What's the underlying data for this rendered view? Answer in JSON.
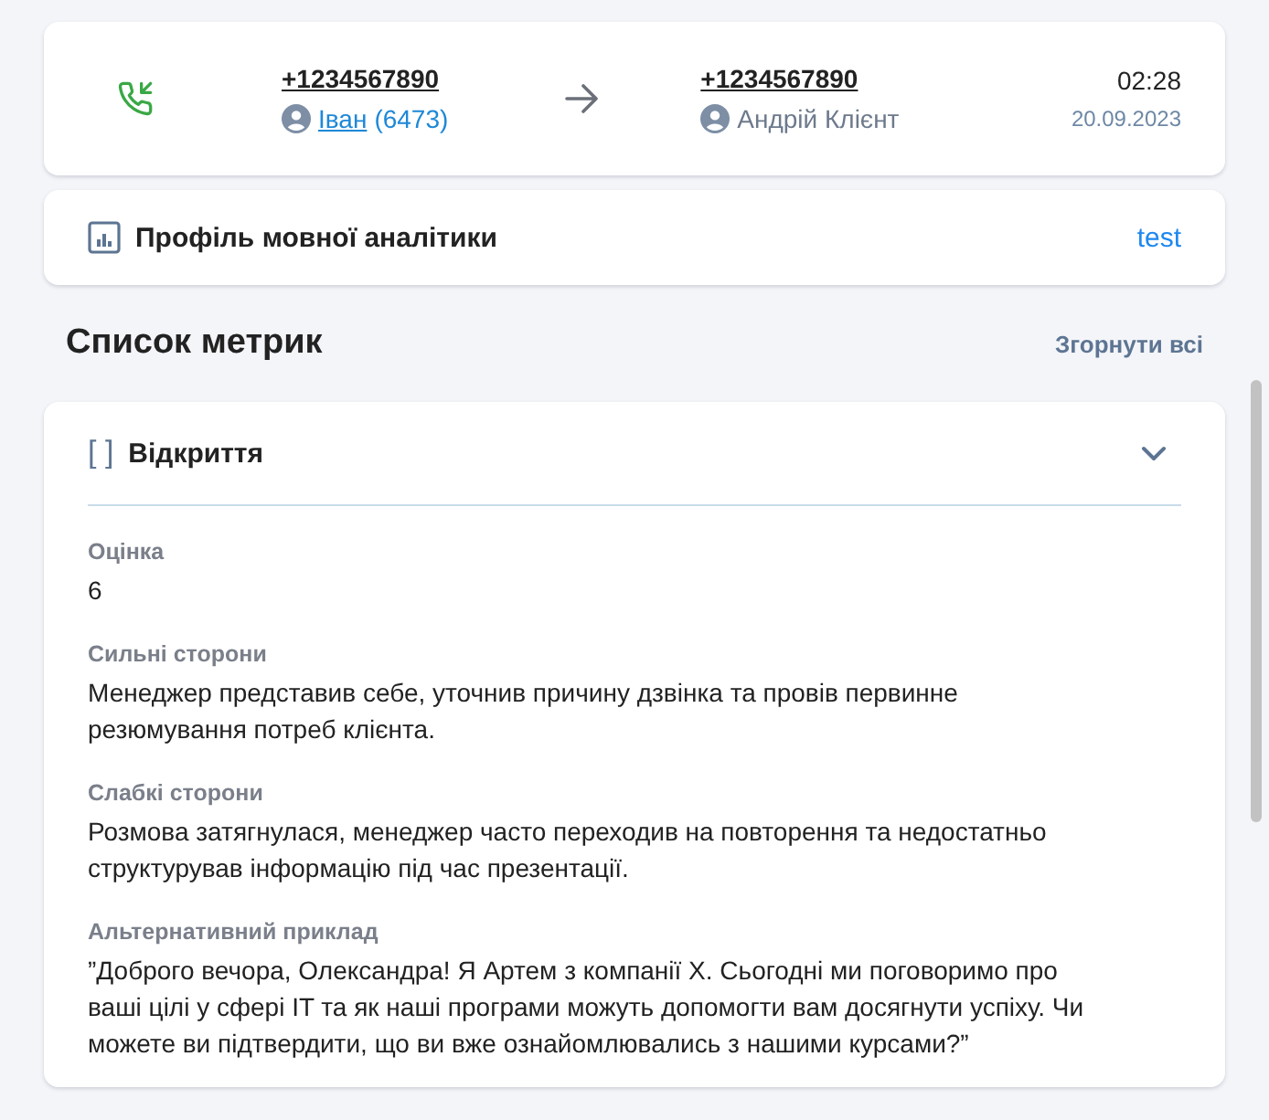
{
  "call": {
    "incoming": true,
    "from_number": "+1234567890",
    "from_user": {
      "name": "Іван",
      "extension": "(6473)"
    },
    "to_number": "+1234567890",
    "to_user": {
      "name": "Андрій Клієнт"
    },
    "duration": "02:28",
    "date": "20.09.2023"
  },
  "profile": {
    "title": "Профіль мовної аналітики",
    "value": "test"
  },
  "metrics_header": {
    "title": "Список метрик",
    "collapse_all": "Згорнути всі"
  },
  "metrics": [
    {
      "marker": "[ ]",
      "title": "Відкриття",
      "expanded": true,
      "fields": [
        {
          "label": "Оцінка",
          "value": "6"
        },
        {
          "label": "Сильні сторони",
          "value": "Менеджер представив себе, уточнив причину дзвінка та провів первинне резюмування потреб клієнта."
        },
        {
          "label": "Слабкі сторони",
          "value": "Розмова затягнулася, менеджер часто переходив на повторення та недостатньо структурував інформацію під час презентації."
        },
        {
          "label": "Альтернативний приклад",
          "value": "”Доброго вечора, Олександра! Я Артем з компанії X. Сьогодні ми поговоримо про ваші цілі у сфері IT та як наші програми можуть допомогти вам досягнути успіху. Чи можете ви підтвердити, що ви вже ознайомлювались з нашими курсами?”"
        }
      ]
    }
  ]
}
